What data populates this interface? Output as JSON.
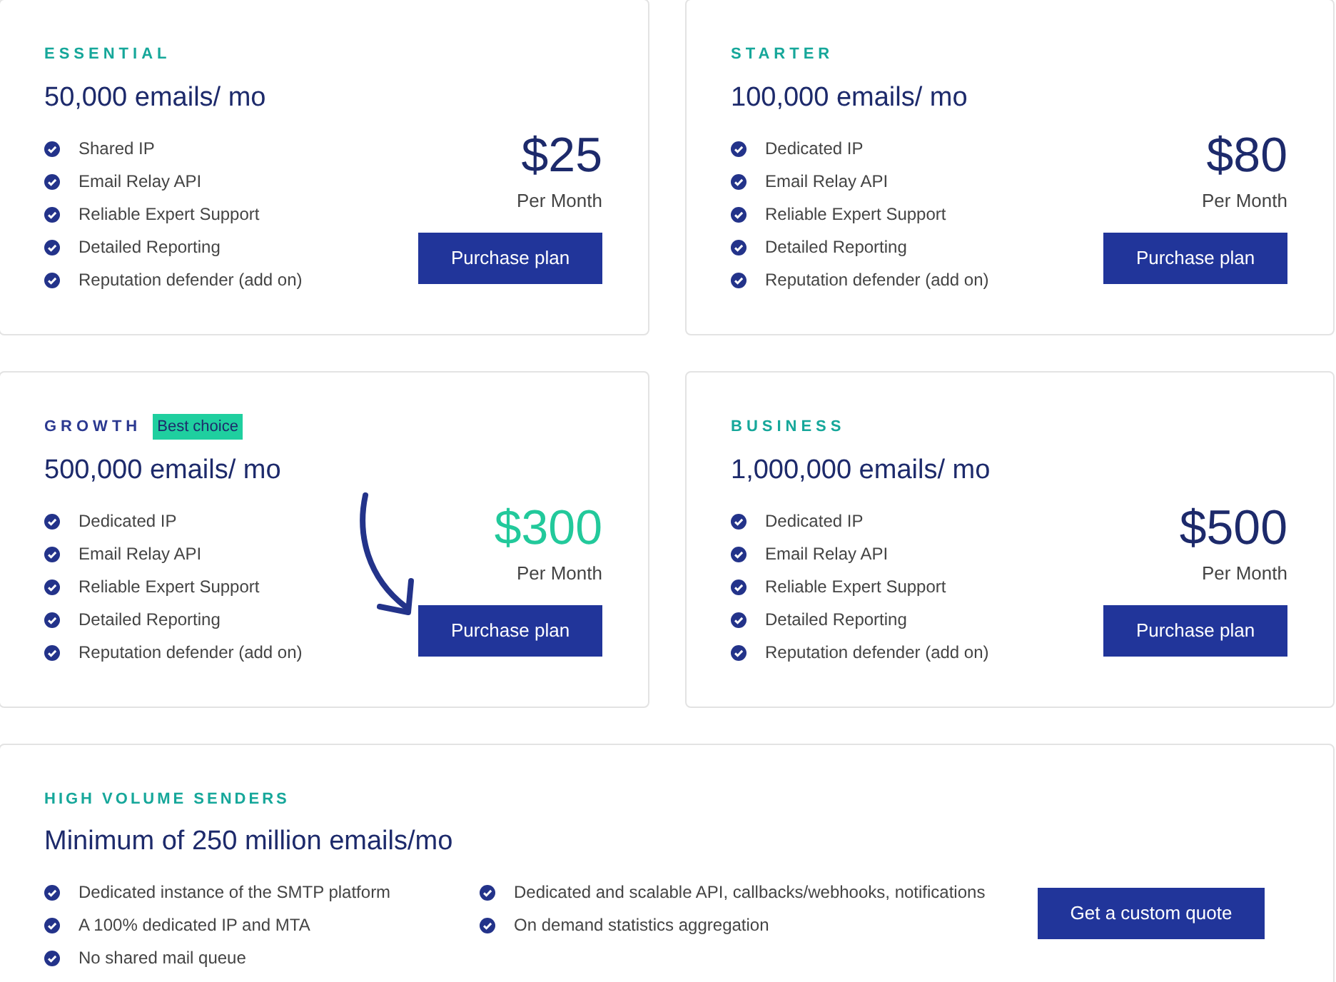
{
  "plans": [
    {
      "label": "ESSENTIAL",
      "featured": false,
      "headline": "50,000 emails/ mo",
      "features": [
        "Shared IP",
        "Email Relay API",
        "Reliable Expert Support",
        "Detailed Reporting",
        "Reputation defender (add on)"
      ],
      "price": "$25",
      "period": "Per Month",
      "button": "Purchase plan"
    },
    {
      "label": "STARTER",
      "featured": false,
      "headline": "100,000 emails/ mo",
      "features": [
        "Dedicated IP",
        "Email Relay API",
        "Reliable Expert Support",
        "Detailed Reporting",
        "Reputation defender (add on)"
      ],
      "price": "$80",
      "period": "Per Month",
      "button": "Purchase plan"
    },
    {
      "label": "GROWTH",
      "featured": true,
      "badge": "Best choice",
      "headline": "500,000 emails/ mo",
      "features": [
        "Dedicated IP",
        "Email Relay API",
        "Reliable Expert Support",
        "Detailed Reporting",
        "Reputation defender (add on)"
      ],
      "price": "$300",
      "period": "Per Month",
      "button": "Purchase plan"
    },
    {
      "label": "BUSINESS",
      "featured": false,
      "headline": "1,000,000 emails/ mo",
      "features": [
        "Dedicated IP",
        "Email Relay API",
        "Reliable Expert Support",
        "Detailed Reporting",
        "Reputation defender (add on)"
      ],
      "price": "$500",
      "period": "Per Month",
      "button": "Purchase plan"
    }
  ],
  "high_volume": {
    "label": "HIGH VOLUME SENDERS",
    "headline": "Minimum of 250 million emails/mo",
    "features_column_1": [
      "Dedicated instance of the SMTP platform",
      "A 100% dedicated IP and MTA",
      "No shared mail queue"
    ],
    "features_column_2": [
      "Dedicated and scalable API, callbacks/webhooks, notifications",
      "On demand statistics aggregation"
    ],
    "button": "Get a custom quote"
  }
}
